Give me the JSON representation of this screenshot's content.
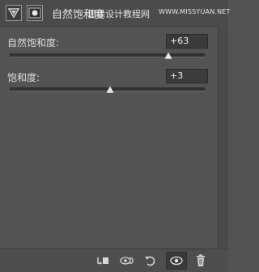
{
  "header": {
    "title": "自然饱和度",
    "watermark": "思缘设计教程网",
    "watermark_url": "WWW.MISSYUAN.NET"
  },
  "properties": [
    {
      "label": "自然饱和度:",
      "value": "+63",
      "level": 0.815
    },
    {
      "label": "饱和度:",
      "value": "+3",
      "level": 0.515
    }
  ],
  "footer": {
    "icons": [
      "clip-to-layer-icon",
      "view-previous-state-icon",
      "reset-icon",
      "toggle-visibility-icon",
      "delete-icon"
    ]
  },
  "colors": {
    "panel_bg": "#535353",
    "field_bg": "#3b3b3b",
    "text": "#dedede"
  }
}
